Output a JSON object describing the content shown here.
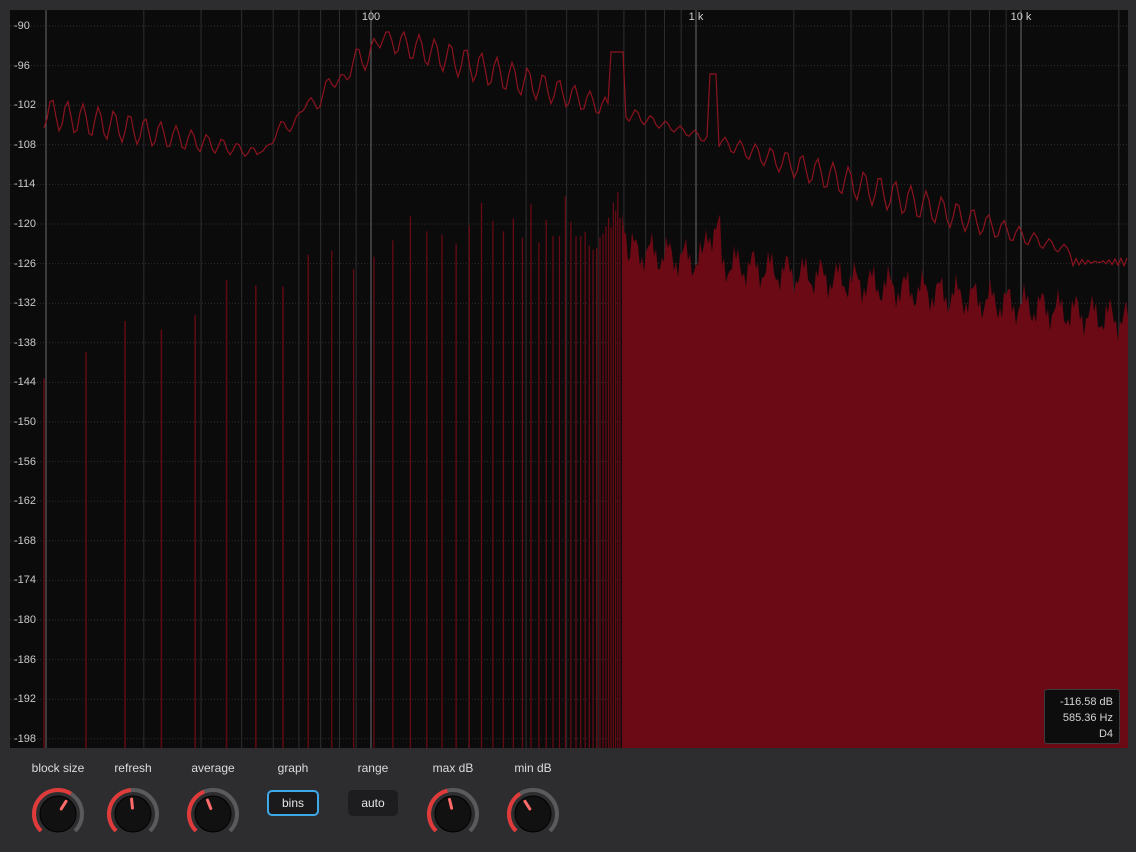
{
  "analyzer": {
    "x_axis_labels": [
      "100",
      "1 k",
      "10 k"
    ],
    "y_axis_labels": [
      "-90",
      "-96",
      "-102",
      "-108",
      "-114",
      "-120",
      "-126",
      "-132",
      "-138",
      "-144",
      "-150",
      "-156",
      "-162",
      "-168",
      "-174",
      "-180",
      "-186",
      "-192",
      "-198"
    ],
    "readout": {
      "level": "-116.58 dB",
      "frequency": "585.36 Hz",
      "note": "D4"
    },
    "colors": {
      "spectrum_fill": "#6b0a14",
      "spectrum_peak_line": "#9a1420",
      "grid": "#3a3a3a",
      "background": "#0b0b0c"
    }
  },
  "controls": {
    "block_size": {
      "label": "block size",
      "icon": "knob-icon",
      "value_fraction": 0.62
    },
    "refresh": {
      "label": "refresh",
      "icon": "knob-icon",
      "value_fraction": 0.48
    },
    "average": {
      "label": "average",
      "icon": "knob-icon",
      "value_fraction": 0.42
    },
    "graph": {
      "label": "graph",
      "value": "bins"
    },
    "range": {
      "label": "range",
      "value": "auto"
    },
    "max_db": {
      "label": "max dB",
      "icon": "knob-icon",
      "value_fraction": 0.45
    },
    "min_db": {
      "label": "min dB",
      "icon": "knob-icon",
      "value_fraction": 0.38
    },
    "accent_color": "#e03a3a",
    "selected_outline": "#3fa8e6"
  }
}
